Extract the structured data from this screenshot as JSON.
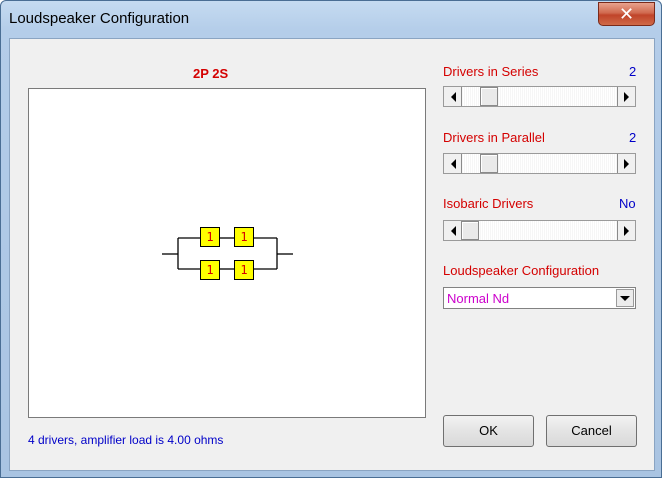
{
  "window": {
    "title": "Loudspeaker Configuration",
    "close_glyph": "✕"
  },
  "diagram": {
    "config_label": "2P 2S",
    "drivers": [
      "1",
      "1",
      "1",
      "1"
    ]
  },
  "controls": {
    "series": {
      "label": "Drivers in Series",
      "value": "2"
    },
    "parallel": {
      "label": "Drivers in Parallel",
      "value": "2"
    },
    "isobaric": {
      "label": "Isobaric Drivers",
      "value": "No"
    },
    "configuration": {
      "label": "Loudspeaker Configuration",
      "selected": "Normal Nd"
    }
  },
  "status": {
    "text": "4 drivers, amplifier load is 4.00 ohms"
  },
  "buttons": {
    "ok": "OK",
    "cancel": "Cancel"
  },
  "colors": {
    "label_red": "#d40000",
    "value_blue": "#0000c8",
    "combo_text": "#cc00cc",
    "driver_fill": "#ffff00"
  }
}
